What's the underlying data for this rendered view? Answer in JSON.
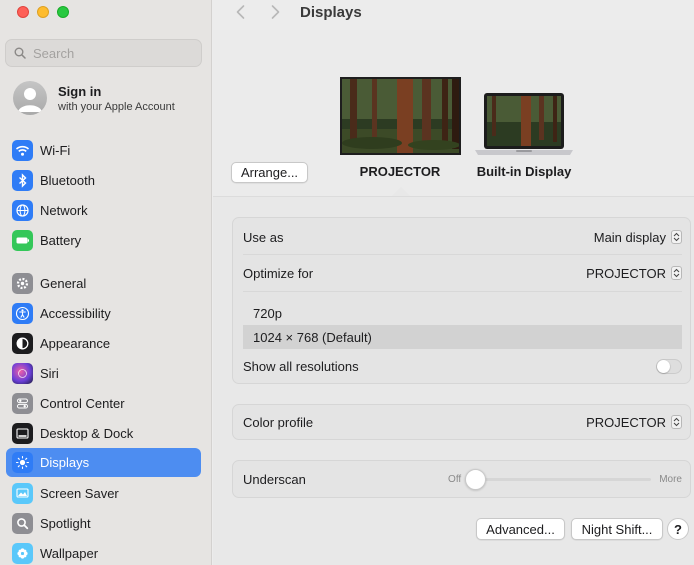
{
  "sidebar": {
    "search": {
      "placeholder": "Search"
    },
    "account": {
      "title": "Sign in",
      "subtitle": "with your Apple Account"
    },
    "items": [
      {
        "label": "Wi-Fi",
        "icon": "wifi-icon",
        "color": "#2f7cf6"
      },
      {
        "label": "Bluetooth",
        "icon": "bluetooth-icon",
        "color": "#2f7cf6"
      },
      {
        "label": "Network",
        "icon": "globe-icon",
        "color": "#2f7cf6"
      },
      {
        "label": "Battery",
        "icon": "battery-icon",
        "color": "#34c759"
      },
      {
        "label": "General",
        "icon": "gear-icon",
        "color": "#8e8e93"
      },
      {
        "label": "Accessibility",
        "icon": "accessibility-icon",
        "color": "#2f7cf6"
      },
      {
        "label": "Appearance",
        "icon": "appearance-icon",
        "color": "#1c1c1e"
      },
      {
        "label": "Siri",
        "icon": "siri-icon",
        "color": "#6a3fd8"
      },
      {
        "label": "Control Center",
        "icon": "control-center-icon",
        "color": "#8e8e93"
      },
      {
        "label": "Desktop & Dock",
        "icon": "dock-icon",
        "color": "#1c1c1e"
      },
      {
        "label": "Displays",
        "icon": "sun-icon",
        "color": "#2f7cf6",
        "active": true
      },
      {
        "label": "Screen Saver",
        "icon": "screen-saver-icon",
        "color": "#5ac8fa"
      },
      {
        "label": "Spotlight",
        "icon": "magnifier-icon",
        "color": "#8e8e93"
      },
      {
        "label": "Wallpaper",
        "icon": "flower-icon",
        "color": "#5ac8fa"
      }
    ]
  },
  "toolbar": {
    "title": "Displays"
  },
  "arrangement": {
    "arrange_label": "Arrange...",
    "displays": [
      {
        "name": "PROJECTOR",
        "selected": true
      },
      {
        "name": "Built-in Display",
        "selected": false
      }
    ]
  },
  "settings": {
    "use_as": {
      "label": "Use as",
      "value": "Main display"
    },
    "optimize_for": {
      "label": "Optimize for",
      "value": "PROJECTOR"
    },
    "resolutions": [
      {
        "label": "720p",
        "selected": false
      },
      {
        "label": "1024 × 768 (Default)",
        "selected": true
      }
    ],
    "show_all_resolutions": {
      "label": "Show all resolutions",
      "enabled": false
    },
    "color_profile": {
      "label": "Color profile",
      "value": "PROJECTOR"
    },
    "underscan": {
      "label": "Underscan",
      "min_label": "Off",
      "max_label": "More",
      "value": 0
    }
  },
  "buttons": {
    "advanced": "Advanced...",
    "night_shift": "Night Shift...",
    "help": "?"
  },
  "colors": {
    "accent": "#4d8df1"
  }
}
